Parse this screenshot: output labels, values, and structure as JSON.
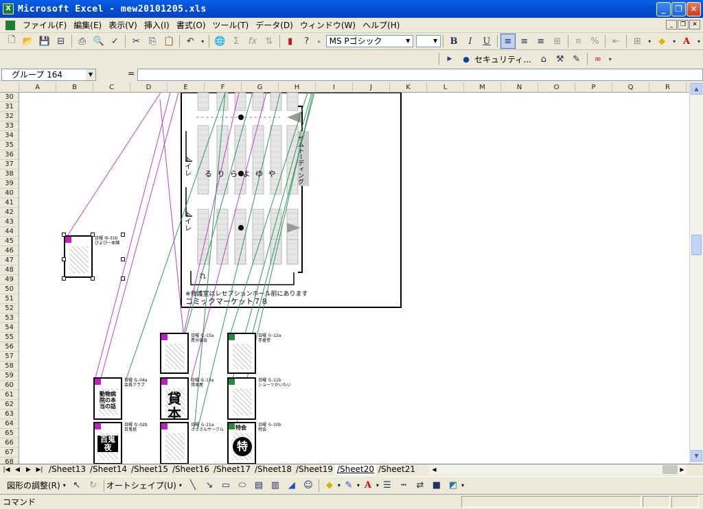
{
  "window": {
    "title": "Microsoft Excel - mew20101205.xls",
    "app_icon_letter": "X"
  },
  "menu": {
    "items": [
      "ファイル(F)",
      "編集(E)",
      "表示(V)",
      "挿入(I)",
      "書式(O)",
      "ツール(T)",
      "データ(D)",
      "ウィンドウ(W)",
      "ヘルプ(H)"
    ]
  },
  "toolbar": {
    "font_name": "MS Pゴシック",
    "font_size": "",
    "bold": "B",
    "italic": "I",
    "underline": "U",
    "security_label": "セキュリティ..."
  },
  "formula_bar": {
    "name_box": "グループ 164",
    "equals": "="
  },
  "grid": {
    "columns": [
      "A",
      "B",
      "C",
      "D",
      "E",
      "F",
      "G",
      "H",
      "I",
      "J",
      "K",
      "L",
      "M",
      "N",
      "O",
      "P",
      "Q",
      "R"
    ],
    "rows": [
      "30",
      "31",
      "32",
      "33",
      "34",
      "35",
      "36",
      "37",
      "38",
      "39",
      "40",
      "41",
      "42",
      "43",
      "44",
      "45",
      "46",
      "47",
      "48",
      "49",
      "50",
      "51",
      "52",
      "53",
      "54",
      "55",
      "56",
      "57",
      "58",
      "59",
      "60",
      "61",
      "62",
      "63",
      "64",
      "65",
      "66",
      "67",
      "68"
    ]
  },
  "map": {
    "toilet_label": "トイレ",
    "row_letters": "る り ら よ ゆ や",
    "row_re": "れ",
    "side_label": "サムトーディング",
    "note": "※救護室はレセプションホール前にあります",
    "event": "コミックマーケット７８"
  },
  "thumbnails": {
    "selected_caption": "日曜 ゆ-31b\nびよぴー本舗",
    "t1_caption": "日曜 な-15a\n異分協会",
    "t2_caption": "日曜 ら-12a\n赤香堂",
    "t3_caption": "日曜 な-04a\n会員クラブ",
    "t4_caption": "日曜 な-13a\n貸本屋",
    "t5_caption": "日曜 ら-11b\nショーツかいたい",
    "t6_caption": "日曜 な-02b\n百鬼夜",
    "t7_caption": "日曜 ら-11a\nさささんサークル",
    "t8_caption": "日曜 ら-10b\n特会",
    "t3_title": "動物病院の本当の話",
    "t4_big": "貸本",
    "t6_title": "百鬼夜",
    "t8_big": "特",
    "t8_head": "特会"
  },
  "sheets": {
    "tabs": [
      "Sheet13",
      "Sheet14",
      "Sheet15",
      "Sheet16",
      "Sheet17",
      "Sheet18",
      "Sheet19",
      "Sheet20",
      "Sheet21"
    ],
    "active": "Sheet20"
  },
  "drawing_toolbar": {
    "adjust_label": "図形の調整(R)",
    "autoshape_label": "オートシェイプ(U)"
  },
  "status": {
    "mode": "コマンド"
  },
  "colors": {
    "connector_magenta": "#c040c0",
    "connector_green": "#2a9a5a",
    "tag_magenta": "#c020c0",
    "tag_green": "#2a8a3a"
  }
}
